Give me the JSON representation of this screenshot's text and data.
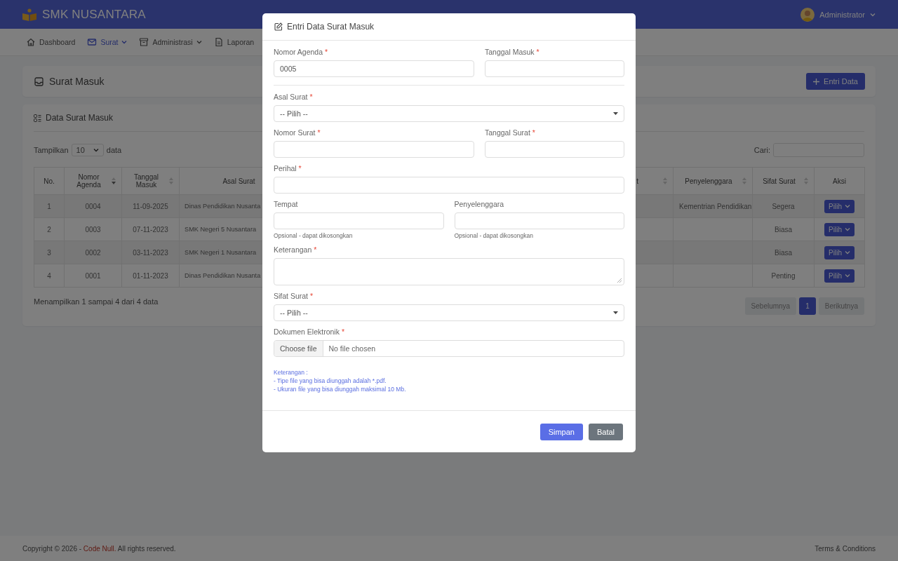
{
  "header": {
    "brand": "SMK NUSANTARA",
    "user": "Administrator"
  },
  "nav": [
    {
      "label": "Dashboard",
      "selected": false,
      "has_menu": false
    },
    {
      "label": "Surat",
      "selected": true,
      "has_menu": true
    },
    {
      "label": "Administrasi",
      "selected": false,
      "has_menu": true
    },
    {
      "label": "Laporan",
      "selected": false,
      "has_menu": false
    }
  ],
  "page_card": {
    "title": "Surat Masuk",
    "button": "Entri Data"
  },
  "data_card": {
    "title": "Data Surat Masuk",
    "length_before": "Tampilkan",
    "length_value": "10",
    "length_after": "data",
    "search_label": "Cari:",
    "columns": [
      {
        "label": "No.",
        "sortable": false
      },
      {
        "label": "Nomor Agenda",
        "sortable": true,
        "sorted": true
      },
      {
        "label": "Tanggal Masuk",
        "sortable": true,
        "sorted": false
      },
      {
        "label": "Asal Surat",
        "sortable": false
      },
      {
        "label": "t",
        "sortable": true,
        "sorted": false
      },
      {
        "label": "Penyelenggara",
        "sortable": true,
        "sorted": false
      },
      {
        "label": "Sifat Surat",
        "sortable": true,
        "sorted": false
      },
      {
        "label": "Aksi",
        "sortable": false
      }
    ],
    "rows": [
      {
        "no": "1",
        "agenda": "0004",
        "tanggal": "11-09-2025",
        "asal": "Dinas Pendidikan Nusanta",
        "penyelenggara": "Kementrian Pendidikan",
        "sifat": "Segera",
        "action": "Pilih"
      },
      {
        "no": "2",
        "agenda": "0003",
        "tanggal": "07-11-2023",
        "asal": "SMK Negeri 5 Nusantara",
        "sifat": "Biasa",
        "action": "Pilih"
      },
      {
        "no": "3",
        "agenda": "0002",
        "tanggal": "03-11-2023",
        "asal": "SMK Negeri 1 Nusantara",
        "sifat": "Biasa",
        "action": "Pilih"
      },
      {
        "no": "4",
        "agenda": "0001",
        "tanggal": "01-11-2023",
        "asal": "Dinas Pendidikan Nusanta",
        "sifat": "Penting",
        "action": "Pilih"
      }
    ],
    "info": "Menampilkan 1 sampai 4 dari 4 data",
    "pagination": {
      "prev": "Sebelumnya",
      "pages": [
        {
          "label": "1",
          "selected": true
        }
      ],
      "next": "Berikutnya"
    }
  },
  "modal": {
    "title": "Entri Data Surat Masuk",
    "rows": [
      {
        "kind": "split",
        "fields": [
          {
            "label": "Nomor Agenda",
            "mark": "*",
            "kind": "input",
            "value": "0005"
          },
          {
            "label": "Tanggal Masuk",
            "mark": "*",
            "kind": "input"
          }
        ]
      },
      {
        "kind": "divider"
      },
      {
        "kind": "full",
        "fields": [
          {
            "label": "Asal Surat",
            "mark": "*",
            "kind": "select",
            "value": "-- Pilih --"
          }
        ]
      },
      {
        "kind": "split",
        "fields": [
          {
            "label": "Nomor Surat",
            "mark": "*",
            "kind": "input"
          },
          {
            "label": "Tanggal Surat",
            "mark": "*",
            "kind": "input"
          }
        ]
      },
      {
        "kind": "full",
        "fields": [
          {
            "label": "Perihal",
            "mark": "*",
            "kind": "input"
          }
        ]
      },
      {
        "kind": "even",
        "fields": [
          {
            "label": "Tempat",
            "kind": "input",
            "help": "Opsional - dapat dikosongkan"
          },
          {
            "label": "Penyelenggara",
            "kind": "input",
            "help": "Opsional - dapat dikosongkan"
          }
        ]
      },
      {
        "kind": "full",
        "fields": [
          {
            "label": "Keterangan",
            "mark": "*",
            "kind": "textarea"
          }
        ]
      },
      {
        "kind": "full",
        "fields": [
          {
            "label": "Sifat Surat",
            "mark": "*",
            "kind": "select",
            "value": "-- Pilih --"
          }
        ]
      },
      {
        "kind": "full",
        "fields": [
          {
            "label": "Dokumen Elektronik",
            "mark": "*",
            "kind": "file",
            "button": "Choose file",
            "status": "No file chosen"
          }
        ]
      }
    ],
    "notes": [
      "Keterangan :",
      "- Tipe file yang bisa diunggah adalah *.pdf.",
      "- Ukuran file yang bisa diunggah maksimal 10 Mb."
    ],
    "buttons": [
      {
        "label": "Simpan",
        "kind": "primary"
      },
      {
        "label": "Batal",
        "kind": "secondary"
      }
    ]
  },
  "footer": {
    "before": "Copyright © 2026 - ",
    "link": "Code Null.",
    "after": " All rights reserved.",
    "terms": "Terms & Conditions"
  }
}
